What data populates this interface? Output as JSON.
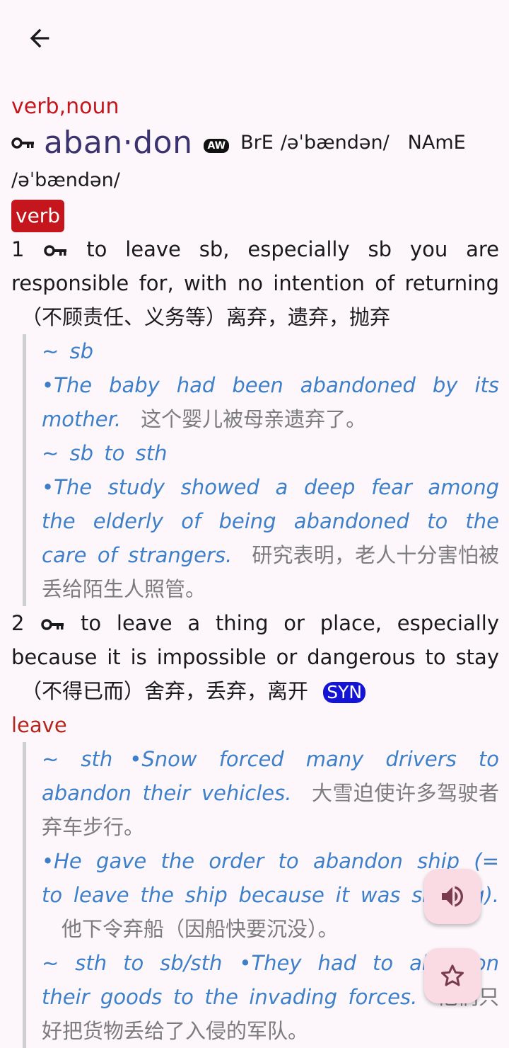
{
  "header": {
    "back_icon": "arrow-left-icon"
  },
  "entry": {
    "pos_heading": "verb,noun",
    "headword": "aban·don",
    "aw_badge": "AW",
    "bre_label": "BrE",
    "bre_pron": "/əˈbændən/",
    "name_label": "NAmE",
    "name_pron": "/əˈbændən/",
    "verb_tag": "verb",
    "senses": [
      {
        "number": "1",
        "definition": "to leave sb, especially sb you are responsible for, with no intention of returning",
        "definition_zh": "（不顾责任、义务等）离弃，遗弃，抛弃",
        "examples": [
          {
            "pattern": "~ sb"
          },
          {
            "en": "•The baby had been abandoned by its mother.",
            "zh": "这个婴儿被母亲遗弃了。"
          },
          {
            "pattern": "~ sb to sth"
          },
          {
            "en": "•The study showed a deep fear among the elderly of being abandoned to the care of strangers.",
            "zh": "研究表明，老人十分害怕被丢给陌生人照管。"
          }
        ]
      },
      {
        "number": "2",
        "definition": "to leave a thing or place, especially because it is impossible or dangerous to stay",
        "definition_zh": "（不得已而）舍弃，丢弃，离开",
        "syn_label": "SYN",
        "syn_word": "leave",
        "examples": [
          {
            "pattern": "~ sth",
            "en": "•Snow forced many drivers to abandon their vehicles.",
            "zh": "大雪迫使许多驾驶者弃车步行。"
          },
          {
            "en": "•He gave the order to abandon ship (= to leave the ship because it was sinking).",
            "zh": "他下令弃船（因船快要沉没）。"
          },
          {
            "pattern": "~ sth to sb/sth",
            "en": "•They had to abandon their goods to the invading forces.",
            "zh": "他们只好把货物丢给了入侵的军队。"
          }
        ]
      }
    ]
  },
  "fabs": {
    "speaker_icon": "speaker-icon",
    "star_icon": "star-icon"
  },
  "colors": {
    "pos": "#c4161c",
    "headword": "#3a3370",
    "example": "#3d7fc9",
    "syn": "#1414d4"
  }
}
